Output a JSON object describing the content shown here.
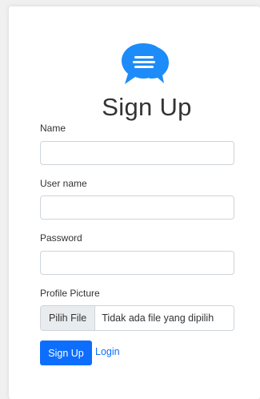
{
  "colors": {
    "primary": "#0d6efd",
    "logo": "#1d8cf8",
    "text": "#333333",
    "input_border": "#ced4da",
    "file_button_bg": "#e9ecef"
  },
  "logo": {
    "icon": "chat-bubbles-icon"
  },
  "title": "Sign Up",
  "form": {
    "name": {
      "label": "Name",
      "value": ""
    },
    "username": {
      "label": "User name",
      "value": ""
    },
    "password": {
      "label": "Password",
      "value": ""
    },
    "profile_picture": {
      "label": "Profile Picture",
      "button_label": "Pilih File",
      "status_text": "Tidak ada file yang dipilih"
    }
  },
  "actions": {
    "signup_label": "Sign Up",
    "login_label": "Login"
  }
}
